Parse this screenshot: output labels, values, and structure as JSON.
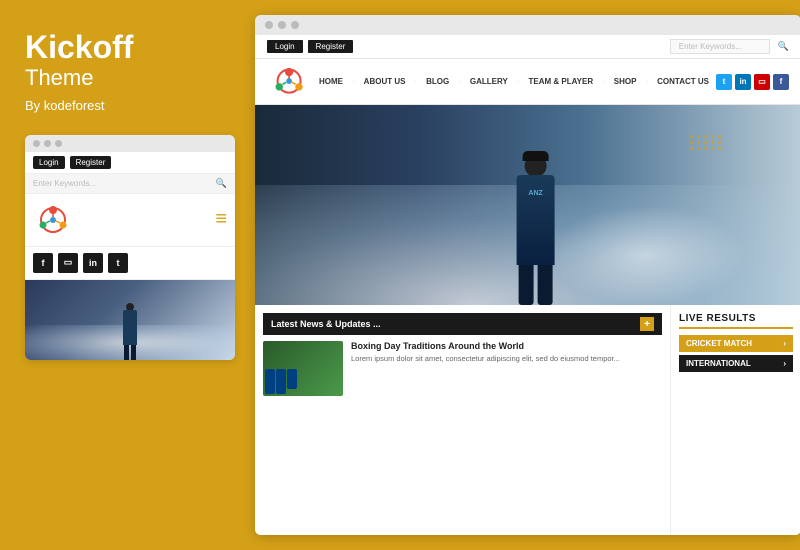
{
  "left": {
    "brand": {
      "title": "Kickoff",
      "subtitle": "Theme",
      "by": "By kodeforest"
    },
    "mini_browser": {
      "buttons": {
        "login": "Login",
        "register": "Register"
      },
      "search_placeholder": "Enter Keywords...",
      "hamburger": "≡",
      "social": [
        "f",
        "▭",
        "in",
        "t"
      ]
    }
  },
  "right": {
    "browser_topbar": {
      "login": "Login",
      "register": "Register",
      "search_placeholder": "Enter Keywords..."
    },
    "nav": {
      "items": [
        "HOME",
        "ABOUT US",
        "BLOG",
        "GALLERY",
        "TEAM & PLAYER",
        "SHOP",
        "CONTACT US"
      ],
      "social": [
        "t",
        "in",
        "▭",
        "f"
      ]
    },
    "news": {
      "header": "Latest News & Updates ...",
      "article_title": "Boxing Day Traditions Around the World",
      "article_body": "Lorem ipsum dolor sit amet, consectetur adipiscing elit, sed do eiusmod tempor..."
    },
    "live": {
      "title": "LIVE RESULTS",
      "items": [
        {
          "label": "CRICKET MATCH",
          "active": true
        },
        {
          "label": "INTERNATIONAL",
          "active": false
        }
      ]
    }
  }
}
